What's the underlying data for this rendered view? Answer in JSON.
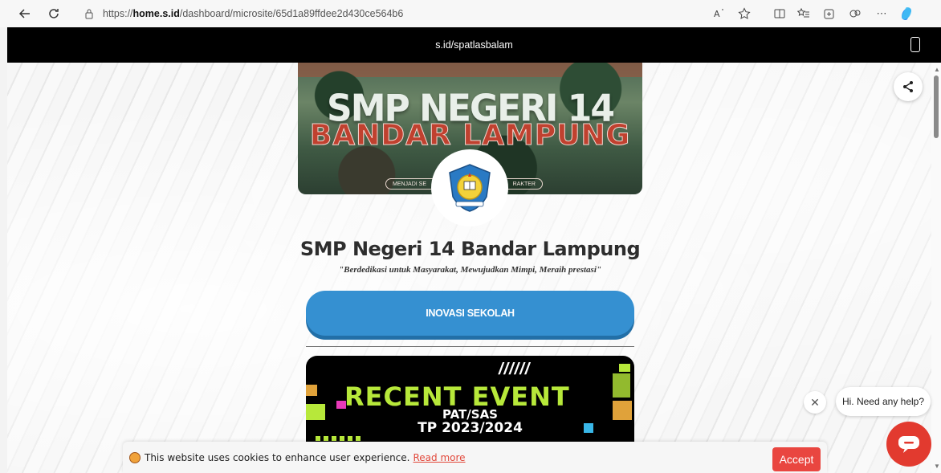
{
  "browser": {
    "url_prefix": "https://",
    "url_host": "home.s.id",
    "url_path": "/dashboard/microsite/65d1a89ffdee2d430ce564b6"
  },
  "preview": {
    "site_url": "s.id/spatlasbalam"
  },
  "banner": {
    "line1": "SMP NEGERI 14",
    "line2": "BANDAR LAMPUNG",
    "tag_left": "MENJADI SE",
    "tag_right": "RAKTER"
  },
  "profile": {
    "title": "SMP Negeri 14 Bandar Lampung",
    "motto": "\"Berdedikasi untuk Masyarakat, Mewujudkan Mimpi, Meraih prestasi\""
  },
  "buttons": {
    "inovasi": "INOVASI SEKOLAH"
  },
  "event_card": {
    "stripes": "//////",
    "heading": "RECENT EVENT",
    "sub1": "PAT/SAS",
    "sub2": "TP 2023/2024"
  },
  "chat": {
    "bubble": "Hi. Need any help?"
  },
  "cookie": {
    "message": "This website uses cookies to enhance user experience.",
    "link": "Read more",
    "accept": "Accept"
  },
  "colors": {
    "cta": "#3590d1",
    "chat": "#e23a2f",
    "accept": "#e94640",
    "event_accent": "#b7e83a"
  }
}
